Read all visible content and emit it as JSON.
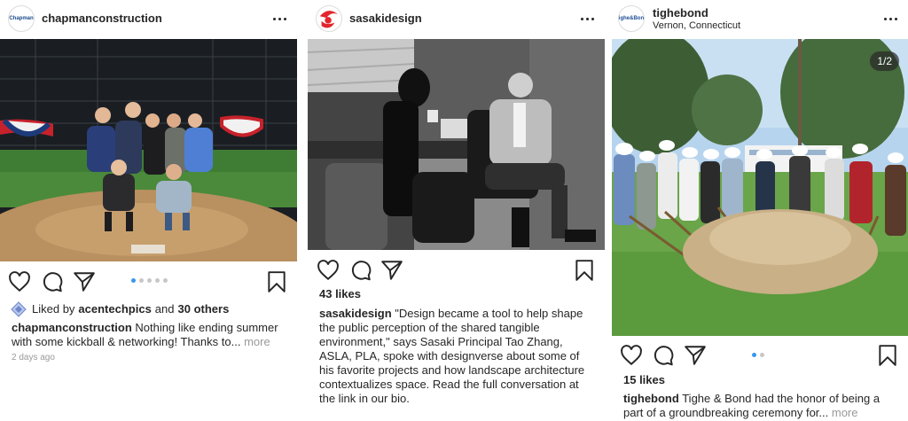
{
  "posts": [
    {
      "username": "chapmanconstruction",
      "avatar_text": "Chapman",
      "liked_by_prefix": "Liked by",
      "liked_by_user": "acentechpics",
      "liked_by_and": "and",
      "liked_by_others": "30 others",
      "caption_user": "chapmanconstruction",
      "caption": "Nothing like ending summer with some kickball & networking! Thanks to...",
      "more_label": "more",
      "time": "2 days ago",
      "carousel_total": 5,
      "carousel_active": 1
    },
    {
      "username": "sasakidesign",
      "likes": "43 likes",
      "caption_user": "sasakidesign",
      "caption": "\"Design became a tool to help shape the public perception of the shared tangible environment,\" says Sasaki Principal Tao Zhang, ASLA, PLA, spoke with designverse about some of his favorite projects and how landscape architecture contextualizes space. Read the full conversation at the link in our bio."
    },
    {
      "username": "tighebond",
      "avatar_text": "Tighe&Bond",
      "location": "Vernon, Connecticut",
      "photo_counter": "1/2",
      "likes": "15 likes",
      "caption_user": "tighebond",
      "caption": "Tighe & Bond had the honor of being a part of a groundbreaking ceremony for...",
      "more_label": "more",
      "carousel_total": 2,
      "carousel_active": 1
    }
  ],
  "icons": [
    "heart-icon",
    "comment-icon",
    "share-icon",
    "bookmark-icon",
    "more-options-icon",
    "liked-by-badge-icon"
  ],
  "colors": {
    "text": "#262626",
    "secondary": "#999999",
    "dot_active": "#3897f0",
    "dot_inactive": "#c7c7c7",
    "chapman_blue": "#1b4a8a",
    "sasaki_red": "#e1262d"
  }
}
